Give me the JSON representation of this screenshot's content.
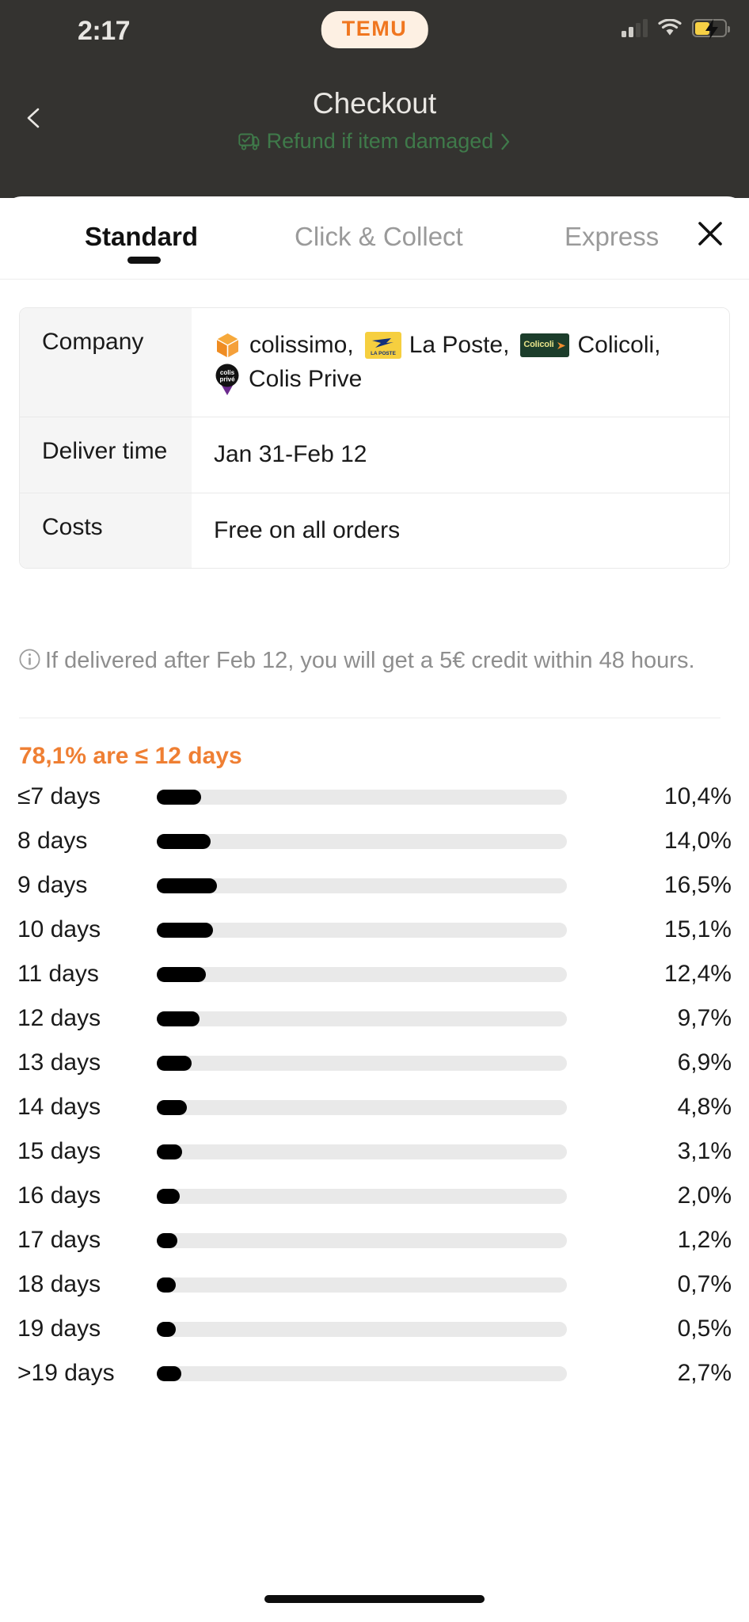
{
  "status_bar": {
    "time": "2:17",
    "brand": "TEMU",
    "signal_icon": "signal-bars-icon",
    "signal_bars_filled": 2,
    "signal_bars_total": 4,
    "wifi_icon": "wifi-icon",
    "battery_icon": "battery-charging-icon"
  },
  "header": {
    "back_icon": "chevron-left-icon",
    "title": "Checkout",
    "refund_icon": "shipping-shield-icon",
    "refund_text": "Refund if item damaged",
    "refund_chevron": "chevron-right-icon"
  },
  "sheet": {
    "tabs": [
      {
        "label": "Standard",
        "active": true
      },
      {
        "label": "Click & Collect",
        "active": false
      },
      {
        "label": "Express",
        "active": false
      }
    ],
    "close_icon": "close-icon",
    "table": {
      "company": {
        "key": "Company",
        "carriers": [
          {
            "name": "colissimo,",
            "logo": "colissimo-logo-icon"
          },
          {
            "name": "La Poste,",
            "logo": "la-poste-logo-icon"
          },
          {
            "name": "Colicoli,",
            "logo": "colicoli-logo-icon",
            "logo_text": "Colicoli"
          },
          {
            "name": "Colis Prive",
            "logo": "colis-prive-logo-icon"
          }
        ]
      },
      "deliver_time": {
        "key": "Deliver time",
        "value": "Jan 31-Feb 12"
      },
      "costs": {
        "key": "Costs",
        "value": "Free on all orders"
      }
    },
    "notice": {
      "icon": "info-circle-icon",
      "text": "If delivered after Feb 12, you will get a 5€ credit within 48 hours."
    }
  },
  "chart_data": {
    "type": "bar",
    "orientation": "horizontal",
    "title": "78,1% are ≤ 12 days",
    "title_color": "#ef7f33",
    "xlabel": "",
    "ylabel": "",
    "grid": false,
    "legend": false,
    "value_suffix": "%",
    "decimal_separator": ",",
    "axis_max_percent": 20,
    "categories": [
      "≤7 days",
      "8 days",
      "9 days",
      "10 days",
      "11 days",
      "12 days",
      "13 days",
      "14 days",
      "15 days",
      "16 days",
      "17 days",
      "18 days",
      "19 days",
      ">19 days"
    ],
    "values": [
      10.4,
      14.0,
      16.5,
      15.1,
      12.4,
      9.7,
      6.9,
      4.8,
      3.1,
      2.0,
      1.2,
      0.7,
      0.5,
      2.7
    ],
    "value_labels": [
      "10,4%",
      "14,0%",
      "16,5%",
      "15,1%",
      "12,4%",
      "9,7%",
      "6,9%",
      "4,8%",
      "3,1%",
      "2,0%",
      "1,2%",
      "0,7%",
      "0,5%",
      "2,7%"
    ],
    "bar_color": "#000000",
    "track_color": "#e9e9e9"
  },
  "home_indicator": "home-indicator"
}
